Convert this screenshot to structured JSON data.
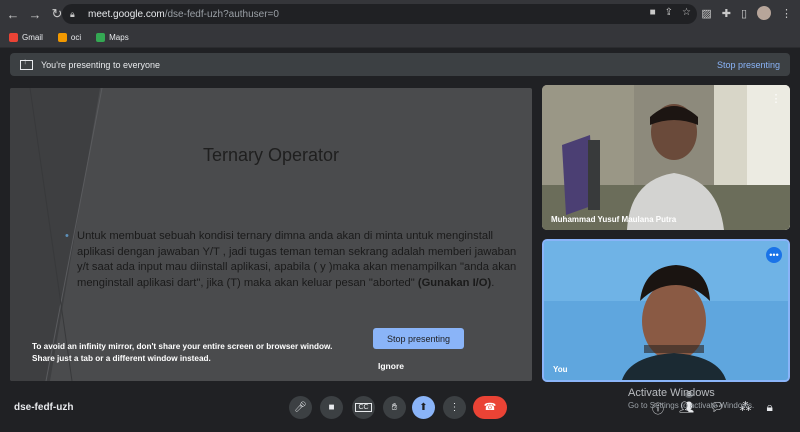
{
  "browser": {
    "url_host": "meet.google.com",
    "url_path": "/dse-fedf-uzh?authuser=0",
    "bookmarks": [
      {
        "label": "Gmail",
        "color": "#ea4335"
      },
      {
        "label": "oci",
        "color": "#f29900"
      },
      {
        "label": "Maps",
        "color": "#34a853"
      }
    ]
  },
  "banner": {
    "text": "You're presenting to everyone",
    "stop_label": "Stop presenting"
  },
  "slide": {
    "title": "Ternary Operator",
    "bullet_text": "Untuk membuat sebuah kondisi ternary dimna anda akan di minta untuk menginstall aplikasi dengan jawaban Y/T , jadi tugas teman teman sekrang adalah memberi jawaban y/t saat ada input mau diinstall aplikasi, apabila ( y )maka akan menampilkan \"anda akan menginstall aplikasi dart\", jika (T)  maka akan keluar pesan \"aborted\" ",
    "bullet_bold": "(Gunakan I/O)",
    "bullet_end": "."
  },
  "mirror_warning": {
    "line1": "To avoid an infinity mirror, don't share your entire screen or browser window.",
    "line2": "Share just a tab or a different window instead.",
    "stop_label": "Stop presenting",
    "ignore_label": "Ignore"
  },
  "participants": [
    {
      "name": "Muhammad Yusuf Maulana Putra"
    },
    {
      "name": "You"
    }
  ],
  "bottom": {
    "meeting_code": "dse-fedf-uzh",
    "people_badge": "3"
  },
  "watermark": {
    "line1": "Activate Windows",
    "line2": "Go to Settings to activate Windows."
  },
  "colors": {
    "accent": "#8ab4f8",
    "end_call": "#ea4335"
  }
}
